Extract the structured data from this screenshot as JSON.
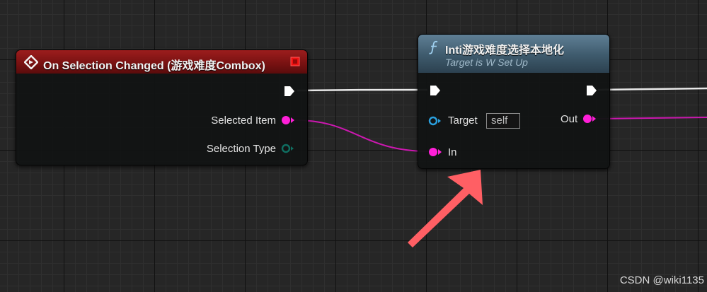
{
  "event_node": {
    "title": "On Selection Changed (游戏难度Combox)",
    "header_color": "#8b1717",
    "pins": {
      "selected_item_label": "Selected Item",
      "selection_type_label": "Selection Type"
    }
  },
  "function_node": {
    "title": "Inti游戏难度选择本地化",
    "subtitle": "Target is W Set Up",
    "header_color": "#4e6c80",
    "pins": {
      "target_label": "Target",
      "target_value": "self",
      "in_label": "In",
      "out_label": "Out"
    }
  },
  "colors": {
    "object_pin": "#ff1fd8",
    "target_pin": "#2aa1e0",
    "enum_pin": "#0f6e61",
    "exec_pin": "#ffffff",
    "annotation_arrow": "#ff5f64"
  },
  "icons": {
    "event": "event-diamond-icon",
    "function": "function-f-icon",
    "delegate": "delegate-square-icon"
  },
  "watermark": "CSDN @wiki1135"
}
